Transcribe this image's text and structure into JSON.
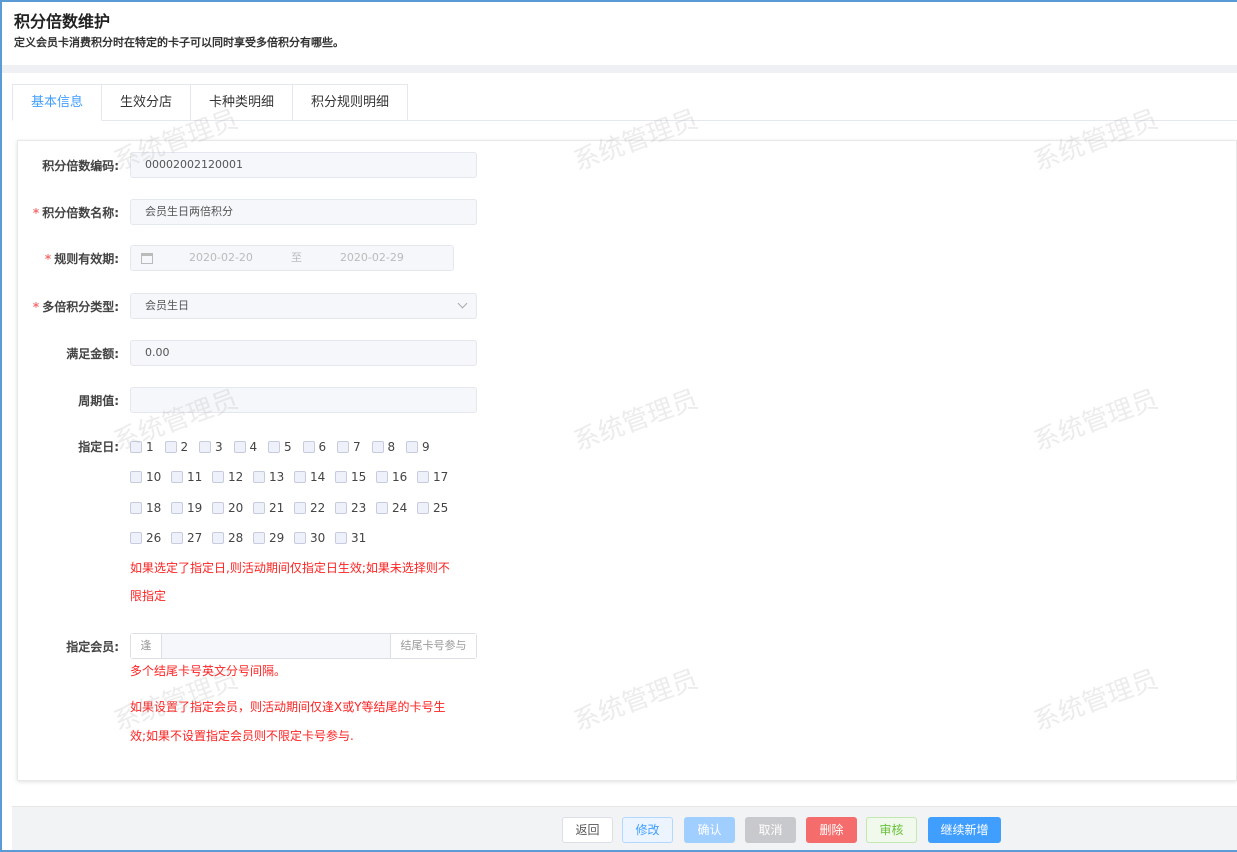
{
  "header": {
    "title": "积分倍数维护",
    "subtitle": "定义会员卡消费积分时在特定的卡子可以同时享受多倍积分有哪些。"
  },
  "tabs": [
    "基本信息",
    "生效分店",
    "卡种类明细",
    "积分规则明细"
  ],
  "watermark": "系统管理员",
  "form": {
    "code": {
      "label": "积分倍数编码:",
      "value": "0000200212000​1"
    },
    "name": {
      "label": "积分倍数名称:",
      "value": "会员生日两倍积分"
    },
    "period": {
      "label": "规则有效期:",
      "start": "2020-02-20",
      "sep": "至",
      "end": "2020-02-29"
    },
    "type": {
      "label": "多倍积分类型:",
      "value": "会员生日"
    },
    "amount": {
      "label": "满足金额:",
      "value": "0.00"
    },
    "cycle": {
      "label": "周期值:",
      "value": ""
    },
    "days": {
      "label": "指定日:",
      "rows": [
        [
          "1",
          "2",
          "3",
          "4",
          "5",
          "6",
          "7",
          "8",
          "9"
        ],
        [
          "10",
          "11",
          "12",
          "13",
          "14",
          "15",
          "16",
          "17"
        ],
        [
          "18",
          "19",
          "20",
          "21",
          "22",
          "23",
          "24",
          "25"
        ],
        [
          "26",
          "27",
          "28",
          "29",
          "30",
          "31"
        ]
      ],
      "note1": "如果选定了指定日,则活动期间仅指定日生效;如果未选择则不",
      "note2": "限指定"
    },
    "member": {
      "label": "指定会员:",
      "prefix": "逢",
      "suffix": "结尾卡号参与",
      "value": "",
      "hint": "多个结尾卡号英文分号间隔。",
      "note1": "如果设置了指定会员，则活动期间仅逢X或Y等结尾的卡号生",
      "note2": "效;如果不设置指定会员则不限定卡号参与."
    }
  },
  "buttons": {
    "back": "返回",
    "edit": "修改",
    "confirm": "确认",
    "cancel": "取消",
    "delete": "删除",
    "audit": "审核",
    "continue": "继续新增"
  }
}
